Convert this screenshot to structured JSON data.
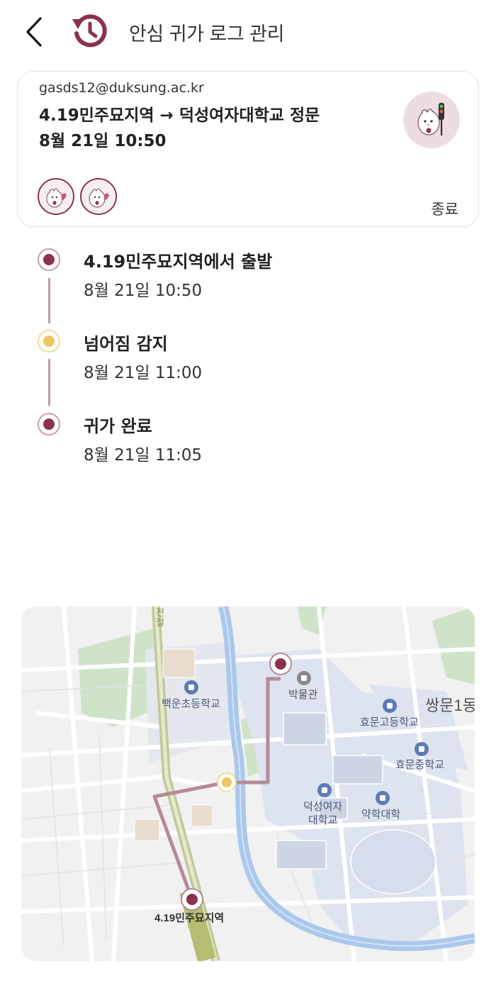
{
  "header": {
    "title": "안심 귀가 로그 관리"
  },
  "card": {
    "email": "gasds12@duksung.ac.kr",
    "route": "4.19민주묘지역 → 덕성여자대학교 정문",
    "time": "8월 21일 10:50",
    "status": "종료",
    "guardian_count": 2
  },
  "timeline": [
    {
      "title": "4.19민주묘지역에서 출발",
      "time": "8월 21일 10:50",
      "type": "start"
    },
    {
      "title": "넘어짐 감지",
      "time": "8월 21일 11:00",
      "type": "alert"
    },
    {
      "title": "귀가 완료",
      "time": "8월 21일 11:05",
      "type": "end"
    }
  ],
  "map": {
    "labels": {
      "station": "4.19민주묘지역",
      "museum": "박물관",
      "elementary": "백운초등학교",
      "highschool": "효문고등학교",
      "middleschool": "효문중학교",
      "university_line1": "덕성여자",
      "university_line2": "대학교",
      "pharmacy": "약학대학",
      "district": "쌍문1동",
      "railway": "전철"
    },
    "colors": {
      "route": "#b58a97",
      "route_end": "#8c3150",
      "alert": "#ecc85f",
      "stream": "#a9c8ec",
      "campus": "#dde3ef",
      "park": "#cfe3c9"
    }
  },
  "colors": {
    "accent": "#8c3150",
    "alert": "#ecc85f",
    "timeline_line": "#c29aa6"
  }
}
